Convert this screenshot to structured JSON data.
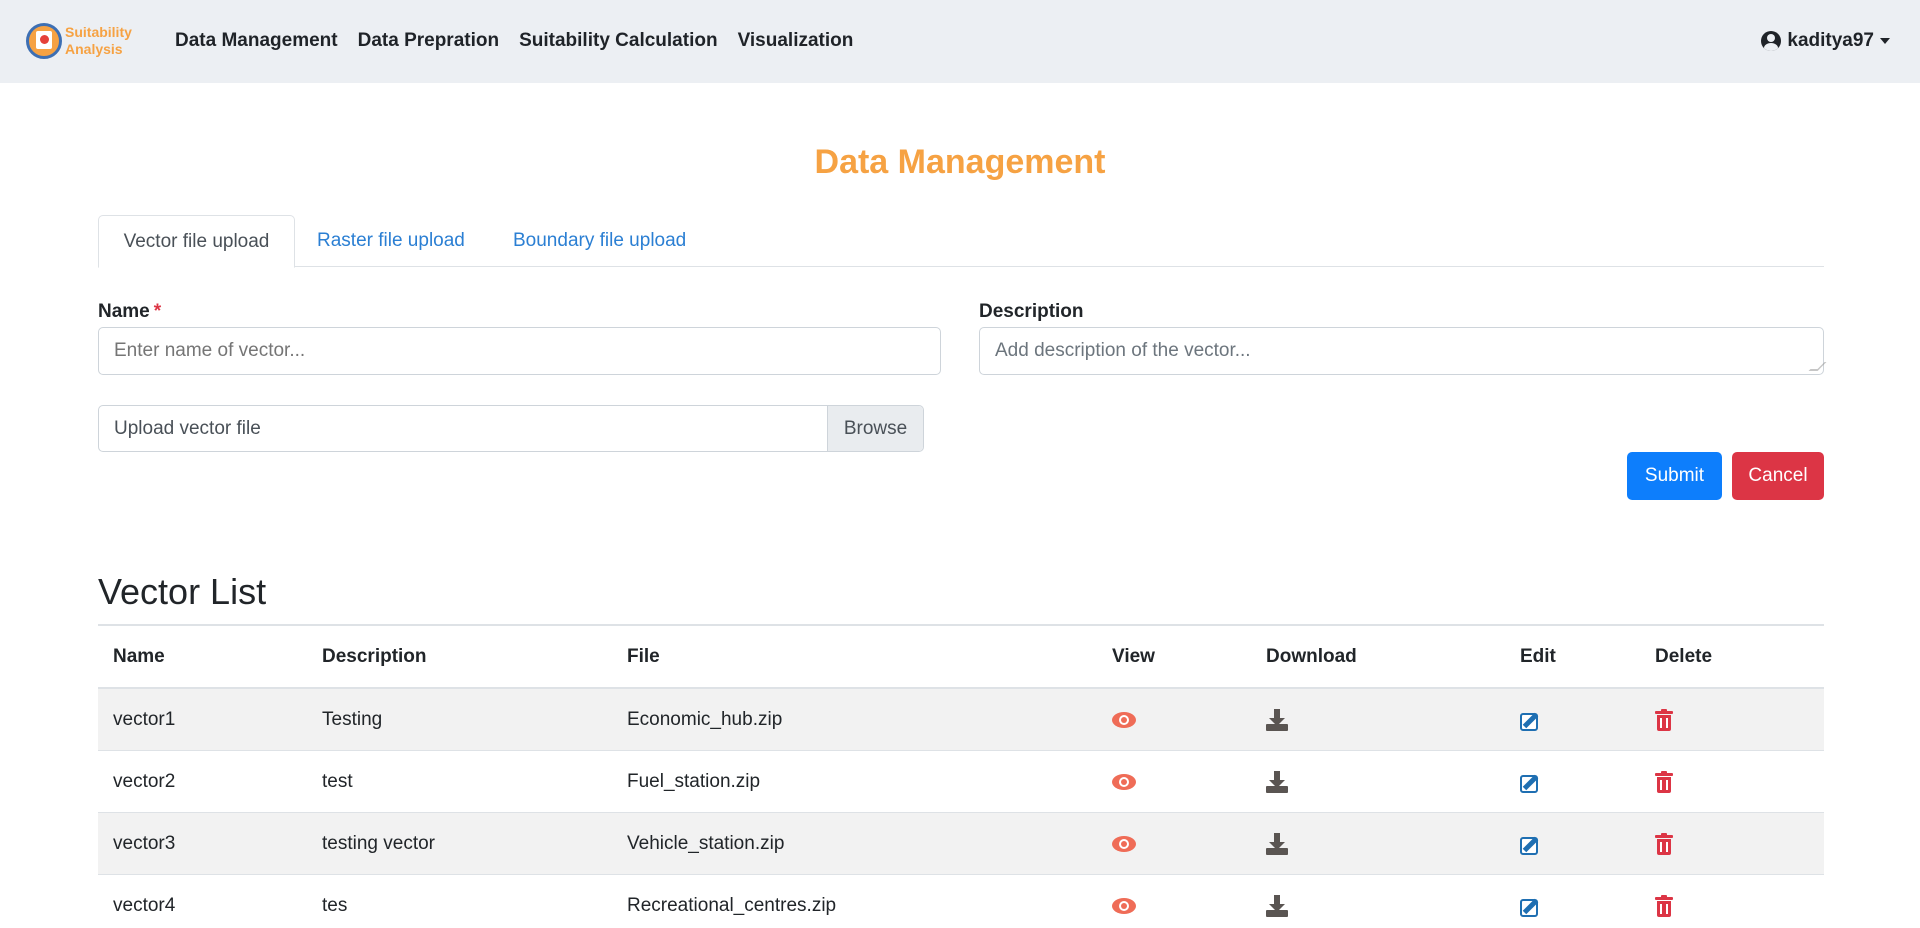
{
  "navbar": {
    "logo_line1": "Suitability",
    "logo_line2": "Analysis",
    "links": [
      "Data Management",
      "Data Prepration",
      "Suitability Calculation",
      "Visualization"
    ],
    "user": "kaditya97"
  },
  "page": {
    "title": "Data Management",
    "tabs": [
      "Vector file upload",
      "Raster file upload",
      "Boundary file upload"
    ],
    "active_tab": "Vector file upload"
  },
  "form": {
    "name_label": "Name",
    "required_mark": "*",
    "name_placeholder": "Enter name of vector...",
    "description_label": "Description",
    "description_placeholder": "Add description of the vector...",
    "file_label": "Upload vector file",
    "browse_label": "Browse",
    "submit_label": "Submit",
    "cancel_label": "Cancel"
  },
  "vector_list": {
    "title": "Vector List",
    "columns": [
      "Name",
      "Description",
      "File",
      "View",
      "Download",
      "Edit",
      "Delete"
    ],
    "rows": [
      {
        "name": "vector1",
        "description": "Testing",
        "file": "Economic_hub.zip"
      },
      {
        "name": "vector2",
        "description": "test",
        "file": "Fuel_station.zip"
      },
      {
        "name": "vector3",
        "description": "testing vector",
        "file": "Vehicle_station.zip"
      },
      {
        "name": "vector4",
        "description": "tes",
        "file": "Recreational_centres.zip"
      }
    ]
  },
  "colors": {
    "accent": "#f6a243",
    "link": "#2b7fd3",
    "submit": "#0d7efc",
    "cancel": "#dc3545",
    "view_icon": "#ef6c57",
    "edit_icon": "#1f6fb2"
  },
  "icons": {
    "view": "eye-icon",
    "download": "download-icon",
    "edit": "edit-icon",
    "delete": "trash-icon",
    "user": "user-circle-icon"
  }
}
